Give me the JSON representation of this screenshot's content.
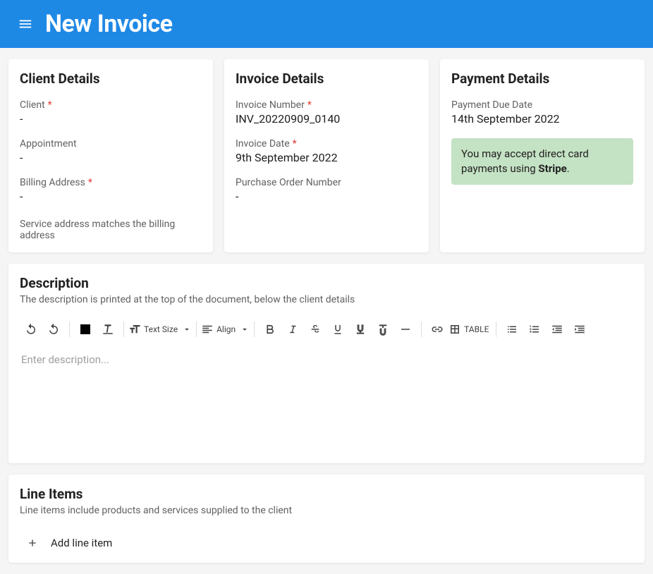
{
  "header": {
    "title": "New Invoice"
  },
  "client_details": {
    "title": "Client Details",
    "client_label": "Client",
    "client_value": "-",
    "appointment_label": "Appointment",
    "appointment_value": "-",
    "billing_label": "Billing Address",
    "billing_value": "-",
    "service_note": "Service address matches the billing address"
  },
  "invoice_details": {
    "title": "Invoice Details",
    "number_label": "Invoice Number",
    "number_value": "INV_20220909_0140",
    "date_label": "Invoice Date",
    "date_value": "9th September 2022",
    "po_label": "Purchase Order Number",
    "po_value": "-"
  },
  "payment_details": {
    "title": "Payment Details",
    "due_label": "Payment Due Date",
    "due_value": "14th September 2022",
    "info_prefix": "You may accept direct card payments using ",
    "info_bold": "Stripe",
    "info_suffix": "."
  },
  "description": {
    "title": "Description",
    "subtitle": "The description is printed at the top of the document, below the client details",
    "placeholder": "Enter description...",
    "toolbar": {
      "text_size_label": "Text Size",
      "align_label": "Align",
      "table_label": "TABLE"
    }
  },
  "line_items": {
    "title": "Line Items",
    "subtitle": "Line items include products and services supplied to the client",
    "add_label": "Add line item"
  }
}
